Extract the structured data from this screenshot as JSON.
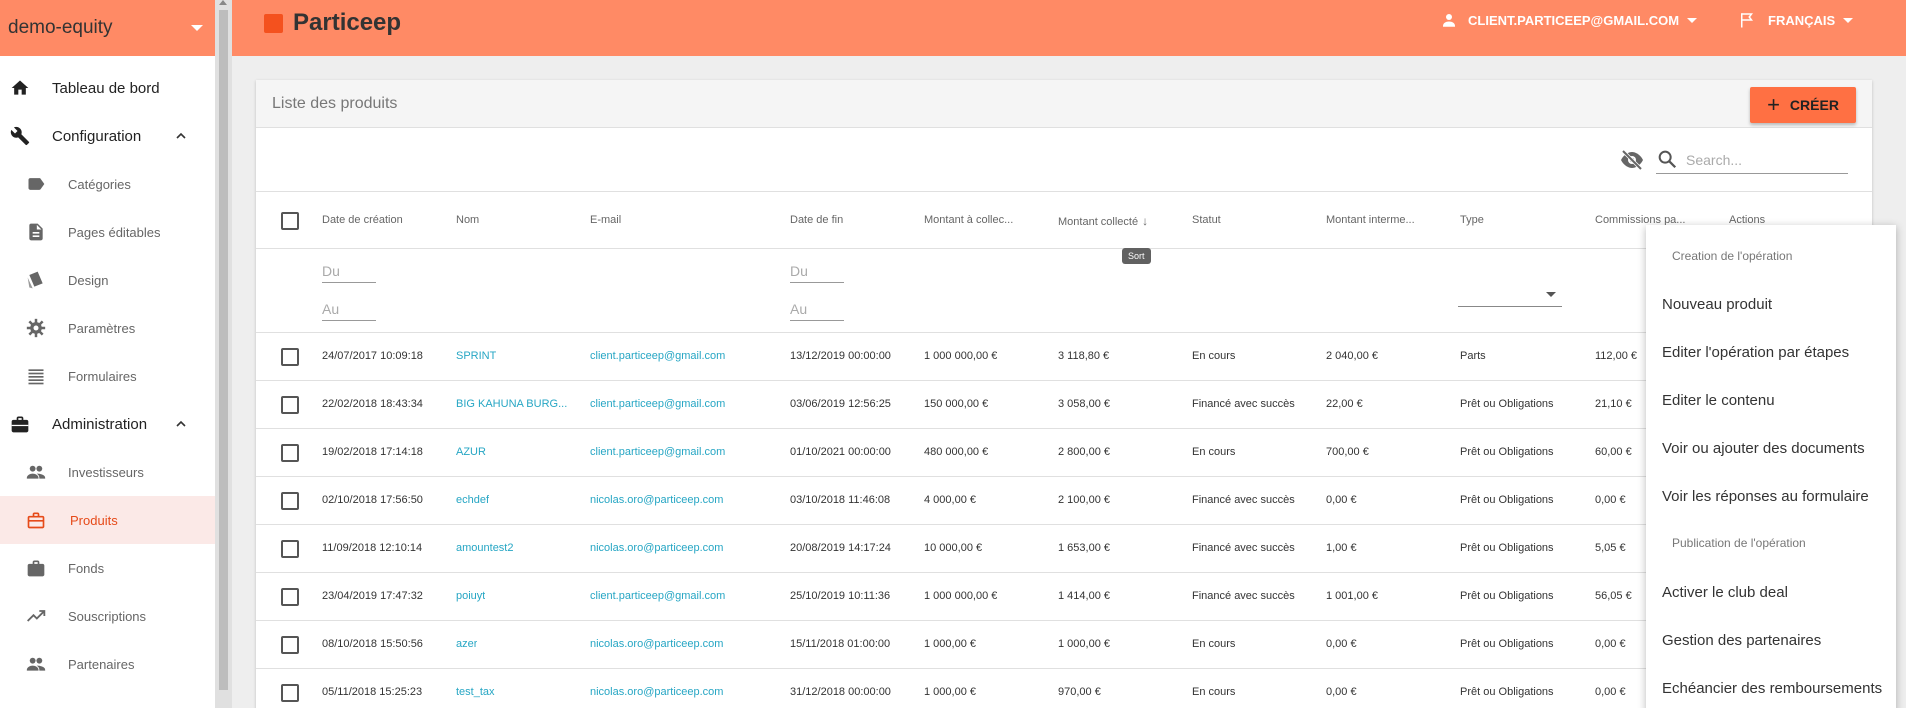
{
  "sidebar": {
    "tenant": "demo-equity",
    "items": [
      {
        "label": "Tableau de bord",
        "icon": "home-icon",
        "level": "top"
      },
      {
        "label": "Configuration",
        "icon": "wrench-icon",
        "level": "top",
        "expanded": true
      },
      {
        "label": "Catégories",
        "icon": "label-icon",
        "level": "sub"
      },
      {
        "label": "Pages éditables",
        "icon": "document-icon",
        "level": "sub"
      },
      {
        "label": "Design",
        "icon": "palette-icon",
        "level": "sub"
      },
      {
        "label": "Paramètres",
        "icon": "gear-icon",
        "level": "sub"
      },
      {
        "label": "Formulaires",
        "icon": "list-icon",
        "level": "sub"
      },
      {
        "label": "Administration",
        "icon": "briefcase-icon",
        "level": "top",
        "expanded": true
      },
      {
        "label": "Investisseurs",
        "icon": "people-icon",
        "level": "sub"
      },
      {
        "label": "Produits",
        "icon": "briefcase-icon",
        "level": "sub",
        "active": true
      },
      {
        "label": "Fonds",
        "icon": "bag-icon",
        "level": "sub"
      },
      {
        "label": "Souscriptions",
        "icon": "trending-up-icon",
        "level": "sub"
      },
      {
        "label": "Partenaires",
        "icon": "people-icon",
        "level": "sub"
      }
    ]
  },
  "header": {
    "brand": "Particeep",
    "user": "CLIENT.PARTICEEP@GMAIL.COM",
    "language": "FRANÇAIS"
  },
  "card": {
    "title": "Liste des produits",
    "create_label": "CRÉER",
    "search_placeholder": "Search...",
    "sort_tooltip": "Sort"
  },
  "table": {
    "columns": [
      "Date de création",
      "Nom",
      "E-mail",
      "Date de fin",
      "Montant à collec...",
      "Montant collecté",
      "Statut",
      "Montant interme...",
      "Type",
      "Commissions pa...",
      "Actions"
    ],
    "filters": {
      "from": "Du",
      "to": "Au"
    },
    "rows": [
      [
        "24/07/2017 10:09:18",
        "SPRINT",
        "client.particeep@gmail.com",
        "13/12/2019 00:00:00",
        "1 000 000,00 €",
        "3 118,80 €",
        "En cours",
        "2 040,00 €",
        "Parts",
        "112,00 €"
      ],
      [
        "22/02/2018 18:43:34",
        "BIG KAHUNA BURG...",
        "client.particeep@gmail.com",
        "03/06/2019 12:56:25",
        "150 000,00 €",
        "3 058,00 €",
        "Financé avec succès",
        "22,00 €",
        "Prêt ou Obligations",
        "21,10 €"
      ],
      [
        "19/02/2018 17:14:18",
        "AZUR",
        "client.particeep@gmail.com",
        "01/10/2021 00:00:00",
        "480 000,00 €",
        "2 800,00 €",
        "En cours",
        "700,00 €",
        "Prêt ou Obligations",
        "60,00 €"
      ],
      [
        "02/10/2018 17:56:50",
        "echdef",
        "nicolas.oro@particeep.com",
        "03/10/2018 11:46:08",
        "4 000,00 €",
        "2 100,00 €",
        "Financé avec succès",
        "0,00 €",
        "Prêt ou Obligations",
        "0,00 €"
      ],
      [
        "11/09/2018 12:10:14",
        "amountest2",
        "nicolas.oro@particeep.com",
        "20/08/2019 14:17:24",
        "10 000,00 €",
        "1 653,00 €",
        "Financé avec succès",
        "1,00 €",
        "Prêt ou Obligations",
        "5,05 €"
      ],
      [
        "23/04/2019 17:47:32",
        "poiuyt",
        "client.particeep@gmail.com",
        "25/10/2019 10:11:36",
        "1 000 000,00 €",
        "1 414,00 €",
        "Financé avec succès",
        "1 001,00 €",
        "Prêt ou Obligations",
        "56,05 €"
      ],
      [
        "08/10/2018 15:50:56",
        "azer",
        "nicolas.oro@particeep.com",
        "15/11/2018 01:00:00",
        "1 000,00 €",
        "1 000,00 €",
        "En cours",
        "0,00 €",
        "Prêt ou Obligations",
        "0,00 €"
      ],
      [
        "05/11/2018 15:25:23",
        "test_tax",
        "nicolas.oro@particeep.com",
        "31/12/2018 00:00:00",
        "1 000,00 €",
        "970,00 €",
        "En cours",
        "0,00 €",
        "Prêt ou Obligations",
        "0,00 €"
      ]
    ]
  },
  "menu": {
    "section1": "Creation de l'opération",
    "items1": [
      "Nouveau produit",
      "Editer l'opération par étapes",
      "Editer le contenu",
      "Voir ou ajouter des documents",
      "Voir les réponses au formulaire"
    ],
    "section2": "Publication de l'opération",
    "items2": [
      "Activer le club deal",
      "Gestion des partenaires",
      "Echéancier des remboursements"
    ]
  },
  "colors": {
    "primary": "#ff8a65",
    "accent": "#ff7043",
    "link": "#26a6c4"
  }
}
